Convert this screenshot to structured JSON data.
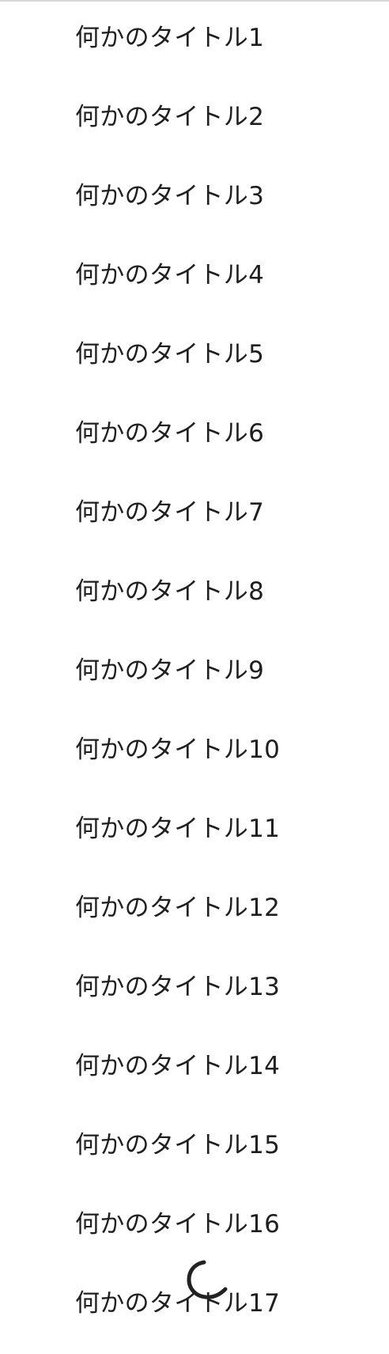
{
  "list": {
    "items": [
      {
        "label": "何かのタイトル1"
      },
      {
        "label": "何かのタイトル2"
      },
      {
        "label": "何かのタイトル3"
      },
      {
        "label": "何かのタイトル4"
      },
      {
        "label": "何かのタイトル5"
      },
      {
        "label": "何かのタイトル6"
      },
      {
        "label": "何かのタイトル7"
      },
      {
        "label": "何かのタイトル8"
      },
      {
        "label": "何かのタイトル9"
      },
      {
        "label": "何かのタイトル10"
      },
      {
        "label": "何かのタイトル11"
      },
      {
        "label": "何かのタイトル12"
      },
      {
        "label": "何かのタイトル13"
      },
      {
        "label": "何かのタイトル14"
      },
      {
        "label": "何かのタイトル15"
      },
      {
        "label": "何かのタイトル16"
      },
      {
        "label": "何かのタイトル17"
      }
    ]
  },
  "loading_indicator": {
    "icon": "loading-spinner-icon",
    "color": "#222222"
  }
}
